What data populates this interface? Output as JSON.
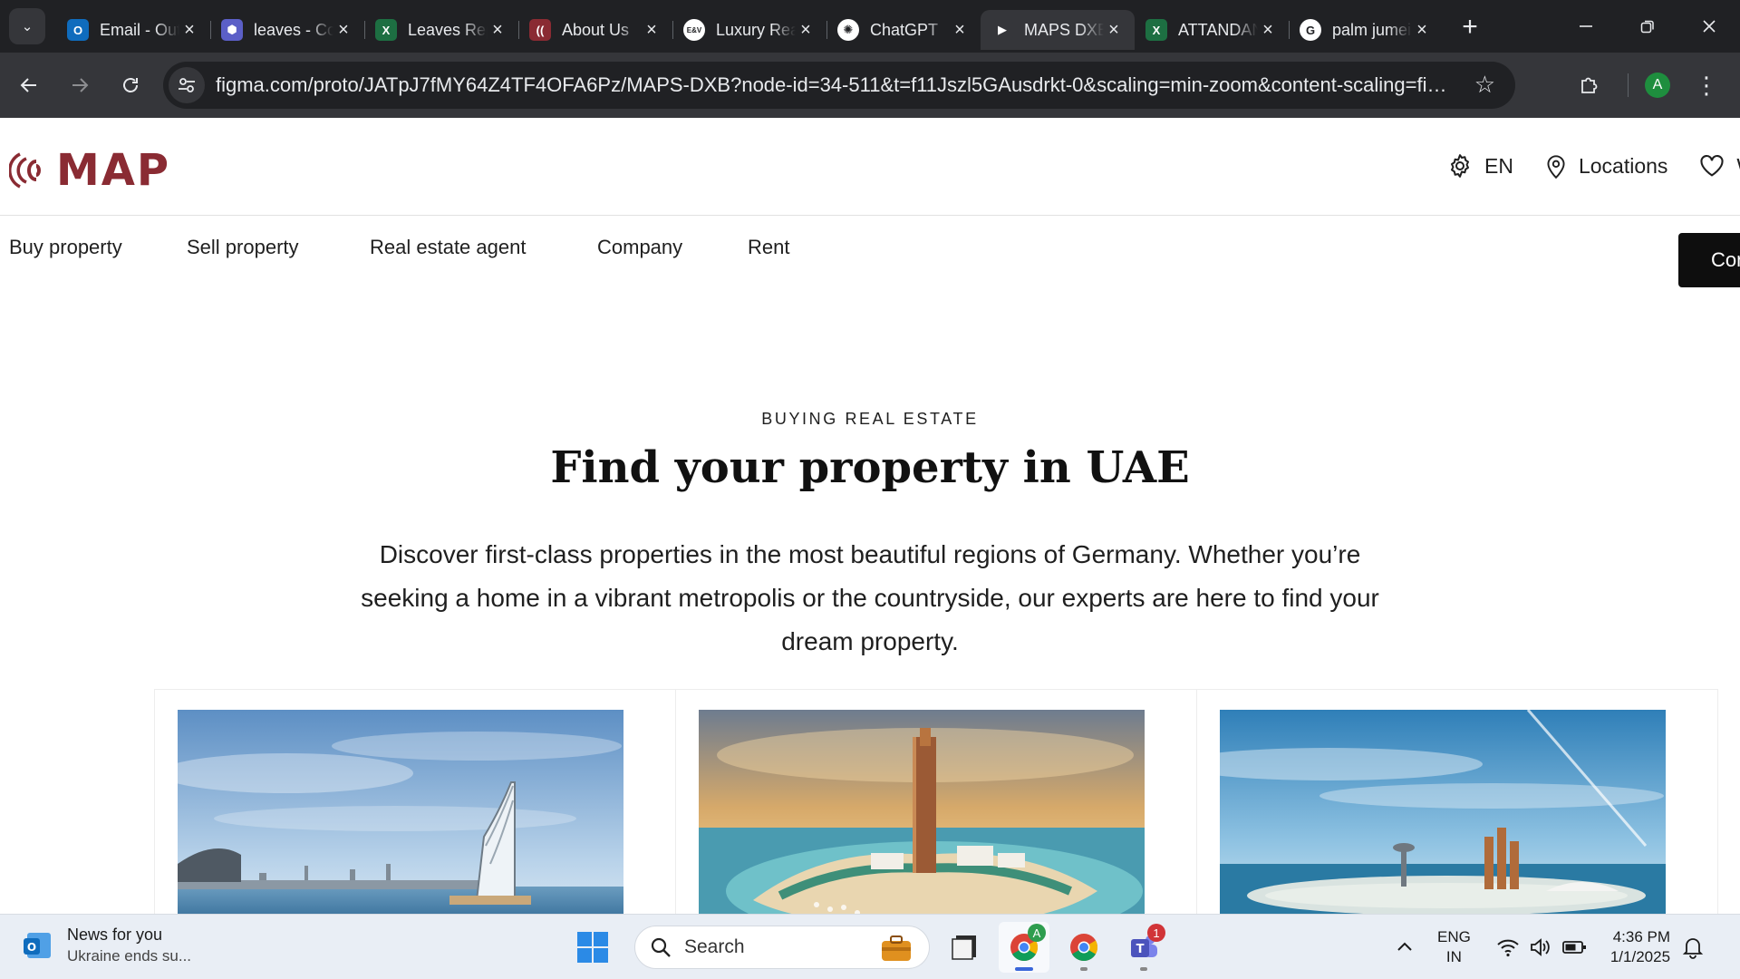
{
  "browser": {
    "tabs": [
      {
        "title": "Email - Outlook",
        "favicon": "outlook-icon",
        "color": "#0f6cbd",
        "glyph": "O"
      },
      {
        "title": "leaves - Copilot",
        "favicon": "copilot-icon",
        "color": "#5b5fc7",
        "glyph": "⬢"
      },
      {
        "title": "Leaves Report",
        "favicon": "excel-icon",
        "color": "#1d6f42",
        "glyph": "X"
      },
      {
        "title": "About Us",
        "favicon": "map-logo-icon",
        "color": "#8a2b33",
        "glyph": "(("
      },
      {
        "title": "Luxury Real Estate",
        "favicon": "ev-icon",
        "color": "#ffffff",
        "glyph": "E&V"
      },
      {
        "title": "ChatGPT",
        "favicon": "chatgpt-icon",
        "color": "#ffffff",
        "glyph": "✺"
      },
      {
        "title": "MAPS DXB",
        "favicon": "figma-play-icon",
        "color": "#35363a",
        "glyph": "▶",
        "active": true
      },
      {
        "title": "ATTANDANCE",
        "favicon": "excel-icon",
        "color": "#1d6f42",
        "glyph": "X"
      },
      {
        "title": "palm jumeirah - Google",
        "favicon": "google-icon",
        "color": "#ffffff",
        "glyph": "G"
      }
    ],
    "url": "figma.com/proto/JATpJ7fMY64Z4TF4OFA6Pz/MAPS-DXB?node-id=34-511&t=f11Jszl5GAusdrkt-0&scaling=min-zoom&content-scaling=fixed&page-i...",
    "profile_initial": "A"
  },
  "site": {
    "logo_text": "MAP",
    "brand_color": "#8a2b33",
    "header": {
      "language": "EN",
      "locations": "Locations",
      "wishlist": "W"
    },
    "nav": [
      "Buy property",
      "Sell property",
      "Real estate agent",
      "Company",
      "Rent"
    ],
    "cta_label": "Contact"
  },
  "hero": {
    "eyebrow": "BUYING REAL ESTATE",
    "title": "Find your property in UAE",
    "description": "Discover first-class properties in the most beautiful regions of Germany. Whether you’re seeking a home in a vibrant metropolis or the countryside, our experts are here to find your dream property."
  },
  "cards": [
    {
      "image": "burj-al-arab-skyline"
    },
    {
      "image": "island-resort-tower"
    },
    {
      "image": "palm-island-aerial"
    }
  ],
  "taskbar": {
    "news_title": "News for you",
    "news_sub": "Ukraine ends su...",
    "search_placeholder": "Search",
    "chrome_badge": "A",
    "teams_badge": "1",
    "lang_line1": "ENG",
    "lang_line2": "IN",
    "time": "4:36 PM",
    "date": "1/1/2025"
  }
}
